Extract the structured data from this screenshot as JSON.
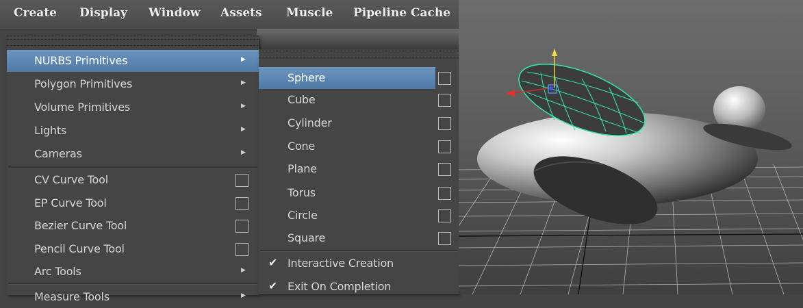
{
  "menubar": {
    "items": [
      "Create",
      "Display",
      "Window",
      "Assets",
      "Muscle",
      "Pipeline Cache"
    ]
  },
  "create_menu": {
    "items": [
      {
        "label": "NURBS Primitives",
        "type": "submenu",
        "highlighted": true
      },
      {
        "label": "Polygon Primitives",
        "type": "submenu"
      },
      {
        "label": "Volume Primitives",
        "type": "submenu"
      },
      {
        "label": "Lights",
        "type": "submenu"
      },
      {
        "label": "Cameras",
        "type": "submenu"
      },
      {
        "label": "CV Curve Tool",
        "type": "option"
      },
      {
        "label": "EP Curve Tool",
        "type": "option"
      },
      {
        "label": "Bezier Curve Tool",
        "type": "option"
      },
      {
        "label": "Pencil Curve Tool",
        "type": "option"
      },
      {
        "label": "Arc Tools",
        "type": "submenu"
      },
      {
        "label": "Measure Tools",
        "type": "submenu",
        "partially_visible": true
      }
    ]
  },
  "nurbs_submenu": {
    "items": [
      {
        "label": "Sphere",
        "highlighted": true
      },
      {
        "label": "Cube"
      },
      {
        "label": "Cylinder"
      },
      {
        "label": "Cone"
      },
      {
        "label": "Plane"
      },
      {
        "label": "Torus"
      },
      {
        "label": "Circle"
      },
      {
        "label": "Square"
      }
    ],
    "toggles": [
      {
        "label": "Interactive Creation",
        "checked": true
      },
      {
        "label": "Exit On Completion",
        "checked": true
      }
    ]
  },
  "colors": {
    "menu_bg": "#454545",
    "highlight": "#5a86b2",
    "text": "#d6d6d6",
    "wireframe": "#35e0a8"
  },
  "icons": {
    "submenu_arrow": "triangle-right",
    "option_box": "square-outline",
    "checkmark": "check"
  }
}
